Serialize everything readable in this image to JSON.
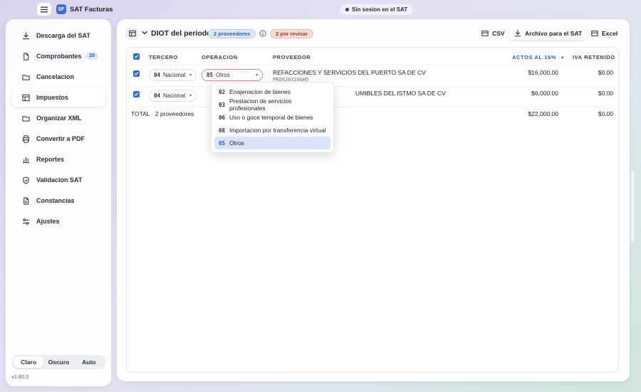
{
  "app": {
    "logo": "SF",
    "name": "SAT Facturas"
  },
  "session": {
    "status": "Sin sesion en el SAT"
  },
  "sidebar": {
    "items": [
      {
        "label": "Descarga del SAT",
        "icon": "download-icon"
      },
      {
        "label": "Comprobantes",
        "icon": "document-icon",
        "badge": "20"
      },
      {
        "label": "Cancelacion",
        "icon": "folder-icon"
      },
      {
        "label": "Impuestos",
        "icon": "table-icon",
        "active": true
      },
      {
        "label": "Organizar XML",
        "icon": "folder-icon"
      },
      {
        "label": "Convertir a PDF",
        "icon": "printer-icon"
      },
      {
        "label": "Reportes",
        "icon": "chart-icon"
      },
      {
        "label": "Validacion SAT",
        "icon": "shield-icon"
      },
      {
        "label": "Constancias",
        "icon": "document-icon"
      },
      {
        "label": "Ajustes",
        "icon": "sliders-icon"
      }
    ],
    "theme": {
      "options": [
        "Claro",
        "Oscuro",
        "Auto"
      ],
      "selected": "Claro"
    },
    "version": "v1.80.0"
  },
  "header": {
    "title": "DIOT del periodo",
    "providers_pill": "2 proveedores",
    "review_pill": "2 por revisar",
    "buttons": {
      "csv": "CSV",
      "sat_file": "Archivo para el SAT",
      "excel": "Excel"
    }
  },
  "table": {
    "columns": {
      "tercero": "TERCERO",
      "operacion": "OPERACION",
      "proveedor": "PROVEEDOR",
      "actos": "ACTOS AL 16%",
      "iva": "IVA RETENIDO"
    },
    "rows": [
      {
        "checked": true,
        "tercero_code": "04",
        "tercero_label": "Nacional",
        "operacion_code": "85",
        "operacion_label": "Otros",
        "proveedor": "REFACCIONES Y SERVICIOS DEL PUERTO SA DE CV",
        "rfc": "PRO920310GH5",
        "actos": "$16,000.00",
        "iva": "$0.00"
      },
      {
        "checked": true,
        "tercero_code": "04",
        "tercero_label": "Nacional",
        "proveedor_visible_tail": "UMIBLES DEL ISTMO SA DE CV",
        "actos": "$6,000.00",
        "iva": "$0.00"
      }
    ],
    "total": {
      "label": "TOTAL · 2 proveedores",
      "actos": "$22,000.00",
      "iva": "$0.00"
    }
  },
  "dropdown": {
    "options": [
      {
        "code": "02",
        "label": "Enajenacion de bienes"
      },
      {
        "code": "03",
        "label": "Prestacion de servicios profesionales"
      },
      {
        "code": "06",
        "label": "Uso o goce temporal de bienes"
      },
      {
        "code": "08",
        "label": "Importacion por transferencia virtual"
      },
      {
        "code": "85",
        "label": "Otros",
        "selected": true
      }
    ]
  }
}
